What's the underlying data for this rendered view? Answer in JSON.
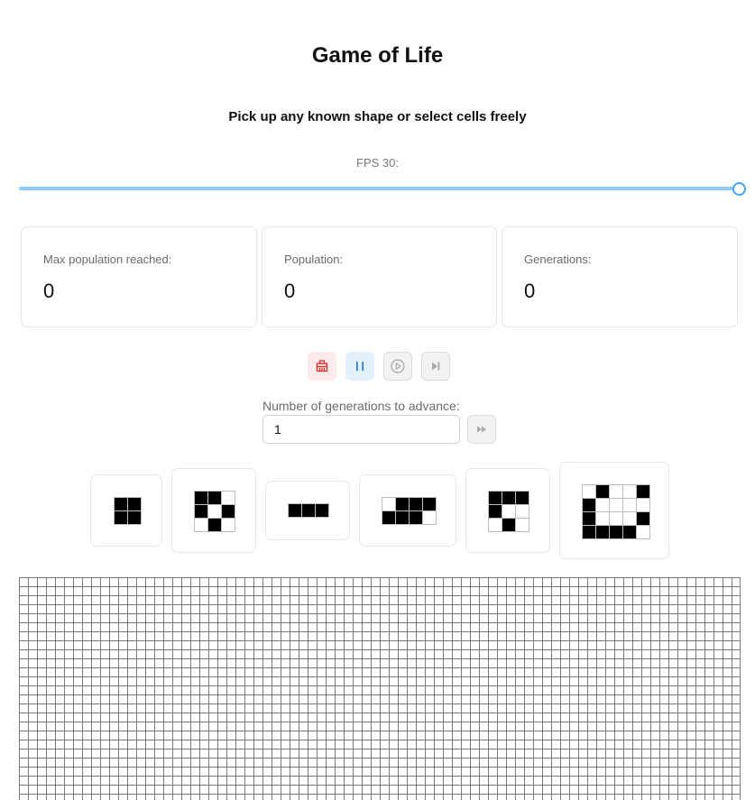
{
  "header": {
    "title": "Game of Life",
    "subtitle": "Pick up any known shape or select cells freely"
  },
  "fps": {
    "label": "FPS 30:",
    "value": 30,
    "fraction": 1.0
  },
  "stats": [
    {
      "label": "Max population reached:",
      "value": "0"
    },
    {
      "label": "Population:",
      "value": "0"
    },
    {
      "label": "Generations:",
      "value": "0"
    }
  ],
  "controls": {
    "clear_icon": "broom-icon",
    "pause_icon": "pause-icon",
    "play_icon": "play-icon",
    "step_icon": "skip-next-icon",
    "advance_icon": "fast-forward-icon",
    "colors": {
      "clear": "#d32f2f",
      "pause": "#1976d2",
      "disabled": "#a8a8a8"
    }
  },
  "advance": {
    "label": "Number of generations to advance:",
    "value": "1"
  },
  "shapes": [
    {
      "name": "block",
      "rows": [
        "11",
        "11"
      ]
    },
    {
      "name": "beacon-like",
      "rows": [
        "110",
        "101",
        "010"
      ]
    },
    {
      "name": "blinker",
      "rows": [
        "111"
      ]
    },
    {
      "name": "toad",
      "rows": [
        "0111",
        "1110"
      ]
    },
    {
      "name": "glider",
      "rows": [
        "111",
        "100",
        "010"
      ]
    },
    {
      "name": "spaceship",
      "rows": [
        "01001",
        "10000",
        "10001",
        "11110"
      ]
    }
  ],
  "board": {
    "colors": {
      "grid": "#7a7a7a",
      "alive": "#000000",
      "dead": "#ffffff"
    }
  }
}
